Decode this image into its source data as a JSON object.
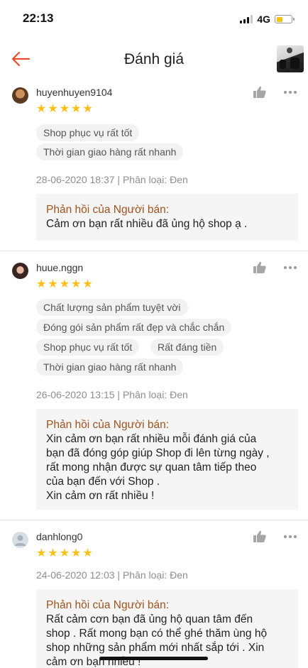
{
  "status_bar": {
    "time": "22:13",
    "network": "4G",
    "battery_level": 0.4
  },
  "header": {
    "title": "Đánh giá",
    "back_icon": "arrow-left-icon",
    "accent_color": "#ee4d2d"
  },
  "reviews": [
    {
      "username": "huyenhuyen9104",
      "rating": 5,
      "tags": [
        "Shop phục vụ rất tốt",
        "Thời gian giao hàng rất nhanh"
      ],
      "meta": "28-06-2020 18:37 | Phân loại: Đen",
      "reply_title": "Phản hồi của Người bán:",
      "reply_text": "Cảm ơn bạn rất nhiều đã ủng hộ shop ạ ."
    },
    {
      "username": "huue.nggn",
      "rating": 5,
      "tags": [
        "Chất lượng sản phẩm tuyệt vời",
        "Đóng gói sản phẩm rất đẹp và chắc chắn",
        "Shop phục vụ rất tốt",
        "Rất đáng tiền",
        "Thời gian giao hàng rất nhanh"
      ],
      "meta": "26-06-2020 13:15 | Phân loại: Đen",
      "reply_title": "Phản hồi của Người bán:",
      "reply_text": "Xin cảm ơn bạn rất nhiều mỗi đánh giá của\nbạn đã đóng góp giúp Shop đi lên từng ngày ,\nrất mong nhận được sự quan tâm tiếp theo\ncủa bạn đến với Shop .\nXin cảm ơn rất nhiều !"
    },
    {
      "username": "danhlong0",
      "rating": 5,
      "tags": [],
      "meta": "24-06-2020 12:03 | Phân loại: Đen",
      "reply_title": "Phản hồi của Người bán:",
      "reply_text": "Rất cảm cơn bạn đã ủng hộ quan tâm đến\nshop . Rất mong bạn có thể ghé thăm ùng hộ\nshop những sản phẩm mới nhất sắp tới . Xin\ncảm ơn bạn nhiều !"
    }
  ]
}
